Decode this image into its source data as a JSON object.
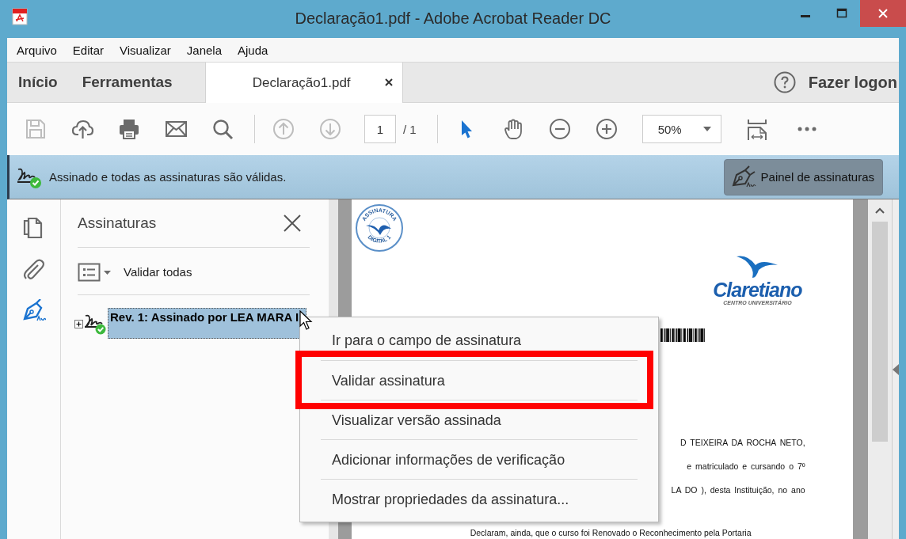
{
  "window": {
    "title": "Declaração1.pdf - Adobe Acrobat Reader DC"
  },
  "menu_bar": [
    "Arquivo",
    "Editar",
    "Visualizar",
    "Janela",
    "Ajuda"
  ],
  "tabs": [
    {
      "label": "Início",
      "kind": "nav",
      "selected": false
    },
    {
      "label": "Ferramentas",
      "kind": "nav",
      "selected": false
    },
    {
      "label": "Declaração1.pdf",
      "kind": "document",
      "selected": true
    }
  ],
  "account": {
    "label": "Fazer logon"
  },
  "toolbar": {
    "groups": [
      [
        {
          "kind": "save",
          "disabled": true,
          "selected": false
        },
        {
          "kind": "upload",
          "disabled": false,
          "selected": false
        },
        {
          "kind": "print",
          "disabled": false,
          "selected": false
        },
        {
          "kind": "mail",
          "disabled": false,
          "selected": false
        },
        {
          "kind": "search",
          "disabled": false,
          "selected": false
        }
      ],
      [
        {
          "kind": "prev",
          "disabled": true,
          "selected": false
        },
        {
          "kind": "next",
          "disabled": true,
          "selected": false
        },
        {
          "kind": "page_field",
          "value": "1"
        },
        {
          "kind": "page_count",
          "text": "/ 1"
        }
      ],
      [
        {
          "kind": "select",
          "disabled": false,
          "selected": true
        },
        {
          "kind": "hand",
          "disabled": false,
          "selected": false
        },
        {
          "kind": "zoom_out",
          "disabled": false,
          "selected": false
        },
        {
          "kind": "zoom_in",
          "disabled": false,
          "selected": false
        },
        {
          "kind": "zoom_field",
          "value": "50%"
        },
        {
          "kind": "fit",
          "disabled": false,
          "selected": false
        },
        {
          "kind": "more",
          "disabled": false,
          "selected": false
        }
      ]
    ]
  },
  "signature_bar": {
    "message": "Assinado e todas as assinaturas são válidas.",
    "button": "Painel de assinaturas"
  },
  "left_rail": [
    {
      "kind": "pages",
      "selected": false
    },
    {
      "kind": "attachments",
      "selected": false
    },
    {
      "kind": "signatures",
      "selected": true
    }
  ],
  "panel": {
    "title": "Assinaturas",
    "options_label": "Validar todas",
    "signatures": [
      {
        "label": "Rev. 1: Assinado por LEA MARA I",
        "selected": true,
        "expanded": false,
        "valid": true
      }
    ]
  },
  "document": {
    "stamp": [
      "ASSINATURA",
      "DIGITAL 1"
    ],
    "logo_name": "Claretiano",
    "logo_subtitle": "CENTRO UNIVERSITÁRIO",
    "lines": [
      "D TEIXEIRA DA ROCHA NETO,",
      "e matriculado e cursando o 7º",
      "LA DO ), desta Instituição, no ano"
    ],
    "footer_line": "Declaram, ainda, que o curso foi Renovado o Reconhecimento pela Portaria"
  },
  "context_menu": {
    "items": [
      {
        "label": "Ir para o campo de assinatura",
        "highlighted": false
      },
      {
        "label": "Validar assinatura",
        "highlighted": true
      },
      {
        "label": "Visualizar versão assinada",
        "highlighted": false
      },
      {
        "label": "Adicionar informações de verificação",
        "highlighted": false
      },
      {
        "label": "Mostrar propriedades da assinatura...",
        "highlighted": false
      }
    ]
  }
}
